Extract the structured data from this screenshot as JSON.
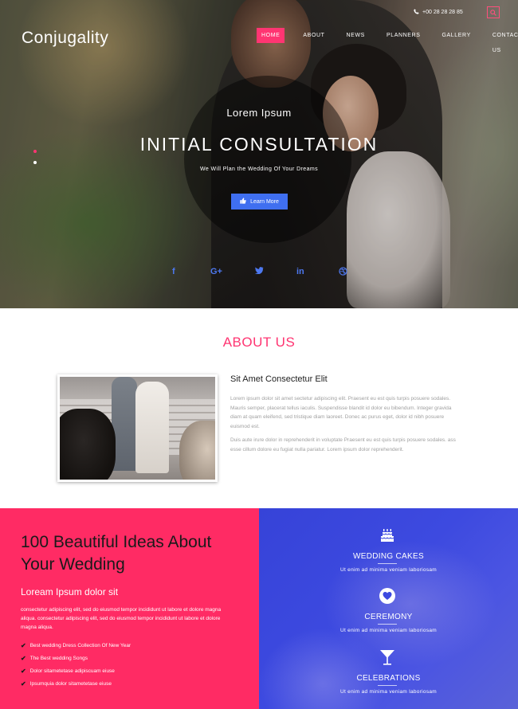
{
  "brand": {
    "logo": "Conjugality"
  },
  "topbar": {
    "phone": "+00 28 28 28 85"
  },
  "nav": {
    "items": [
      "HOME",
      "ABOUT",
      "NEWS",
      "PLANNERS",
      "GALLERY",
      "CONTACT US"
    ]
  },
  "hero": {
    "kicker": "Lorem Ipsum",
    "title": "INITIAL CONSULTATION",
    "subtitle": "We Will Plan the Wedding Of Your Dreams",
    "button_label": "Learn More",
    "social": [
      "f",
      "G+",
      "t",
      "in",
      "dribbble"
    ]
  },
  "about": {
    "title": "ABOUT US",
    "heading": "Sit Amet Consectetur Elit",
    "para1": "Lorem ipsum dolor sit amet sectetur adipiscing elit. Praesent eu est quis turpis posuere sodales. Mauris semper, placerat tellus iaculis. Suspendisse blandit id dolor eu bibendum. Integer gravida diam at quam eleifend, sed tristique diam laoreet. Donec ac purus eget, dolor id nibh posuere euismod est.",
    "para2": "Duis aute irure dolor in reprehenderit in voluptate Praesent eu est quis turpis posuere sodales. ass esse cillum dolore eu fugiat nulla pariatur. Lorem ipsum dolor reprehenderit."
  },
  "ideas": {
    "title": "100 Beautiful Ideas About Your Wedding",
    "subtitle": "Loream Ipsum dolor sit",
    "paragraph": "consectetur adipiscing elit, sed do eiusmod tempor incididunt ut labore et dolore magna aliqua. consectetur adipiscing elit, sed do eiusmod tempor incididunt ut labore et dolore magna aliqua.",
    "list": [
      "Best wedding Dress Collection Of New Year",
      "The Best wedding Songs",
      "Dolor sitametetase adipiscuam eiuse",
      "Ipsumquia dolor sitametetase eiuse"
    ]
  },
  "services": [
    {
      "title": "WEDDING CAKES",
      "text": "Ut enim ad minima veniam laboriosam",
      "icon": "cake-icon"
    },
    {
      "title": "CEREMONY",
      "text": "Ut enim ad minima veniam laboriosam",
      "icon": "heart-icon"
    },
    {
      "title": "CELEBRATIONS",
      "text": "Ut enim ad minima veniam laboriosam",
      "icon": "cocktail-icon"
    }
  ],
  "colors": {
    "accent": "#ff3572",
    "blue": "#3f6ff0",
    "panel_blue": "#3d4ae0",
    "panel_pink": "#ff2b64"
  }
}
